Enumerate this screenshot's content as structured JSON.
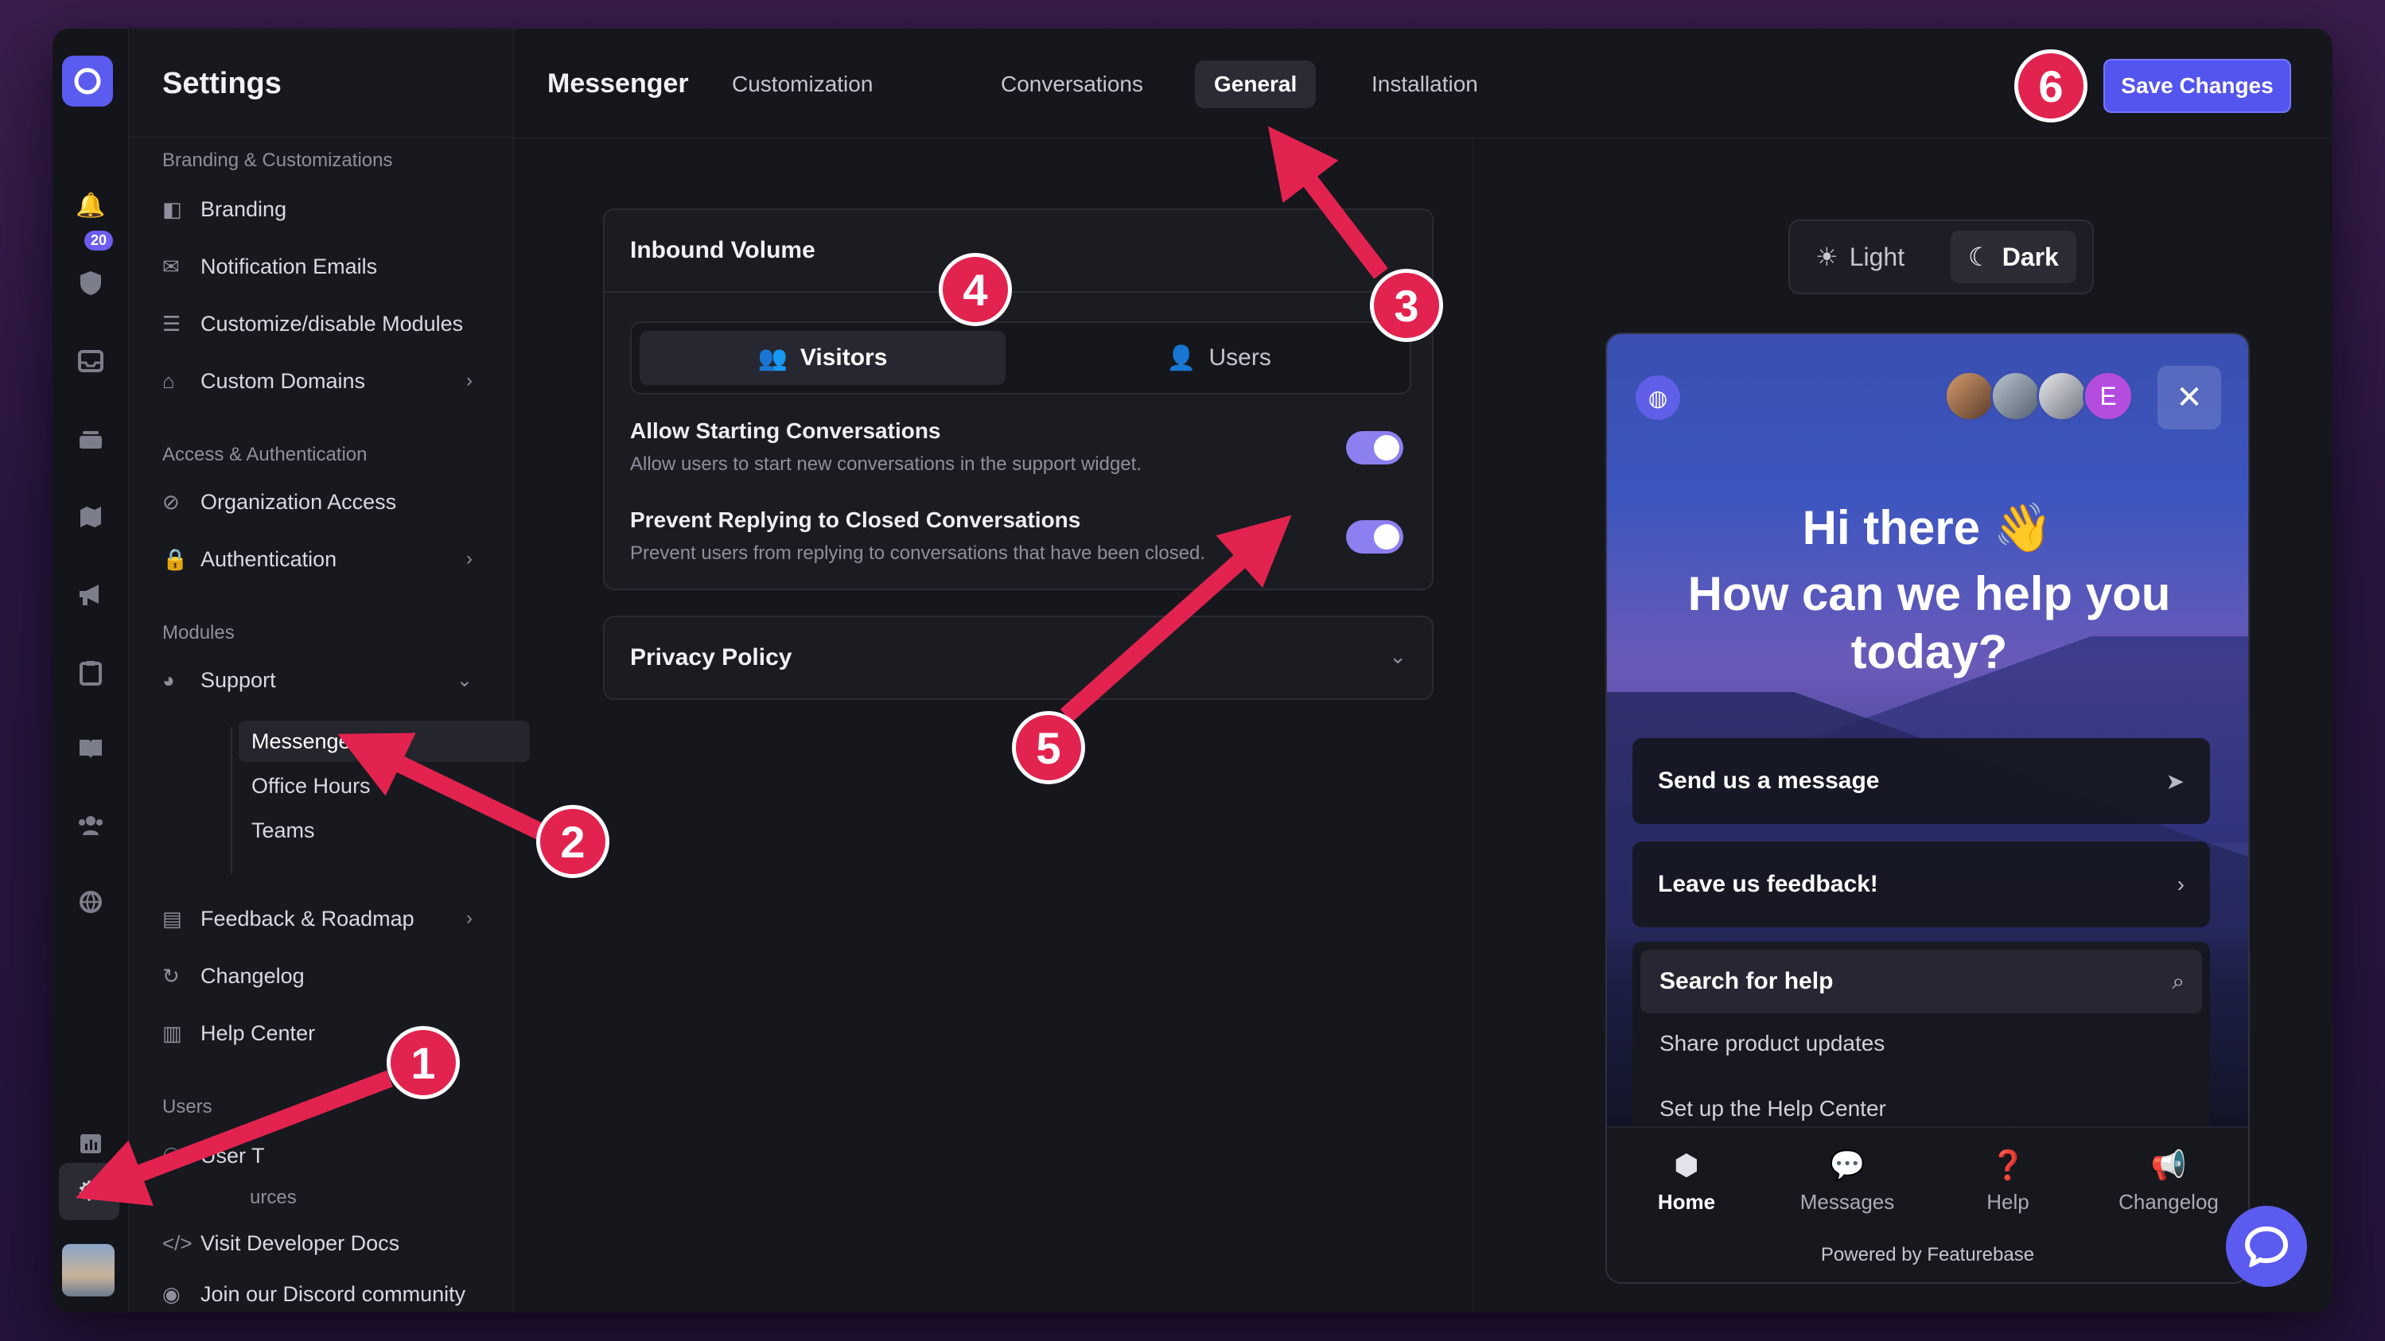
{
  "rail": {
    "badge": "20",
    "icons": [
      "bell-icon",
      "shield-check-icon",
      "inbox-icon",
      "stack-icon",
      "map-icon",
      "megaphone-icon",
      "clipboard-icon",
      "book-icon",
      "users-icon",
      "globe-icon",
      "chart-icon",
      "gear-icon"
    ]
  },
  "sidebar": {
    "title": "Settings",
    "sections": {
      "branding": "Branding & Customizations",
      "access": "Access & Authentication",
      "modules": "Modules",
      "users": "Users",
      "resources": "urces"
    },
    "items": {
      "branding": "Branding",
      "notification_emails": "Notification Emails",
      "customize_modules": "Customize/disable Modules",
      "custom_domains": "Custom Domains",
      "organization_access": "Organization Access",
      "authentication": "Authentication",
      "support": "Support",
      "messenger": "Messenger",
      "office_hours": "Office Hours",
      "teams": "Teams",
      "feedback_roadmap": "Feedback & Roadmap",
      "changelog": "Changelog",
      "help_center": "Help Center",
      "user_tags": "User T",
      "developer_docs": "Visit Developer Docs",
      "discord": "Join our Discord community"
    }
  },
  "topbar": {
    "title": "Messenger",
    "tabs": [
      "Customization",
      "Conversations",
      "General",
      "Installation"
    ],
    "active_tab": "General",
    "save_label": "Save Changes"
  },
  "inbound": {
    "title": "Inbound Volume",
    "segments": [
      "Visitors",
      "Users"
    ],
    "active_segment": "Visitors",
    "options": [
      {
        "title": "Allow Starting Conversations",
        "desc": "Allow users to start new conversations in the support widget.",
        "enabled": true
      },
      {
        "title": "Prevent Replying to Closed Conversations",
        "desc": "Prevent users from replying to conversations that have been closed.",
        "enabled": true
      }
    ]
  },
  "privacy": {
    "title": "Privacy Policy"
  },
  "preview": {
    "modes": [
      "Light",
      "Dark"
    ],
    "active_mode": "Dark",
    "avatar_letter": "E",
    "greeting": "Hi there 👋",
    "question": "How can we help you today?",
    "send_message": "Send us a message",
    "feedback": "Leave us feedback!",
    "search": "Search for help",
    "links": [
      "Share product updates",
      "Set up the Help Center"
    ],
    "nav": [
      "Home",
      "Messages",
      "Help",
      "Changelog"
    ],
    "powered_by": "Powered by Featurebase"
  },
  "annotations": [
    "1",
    "2",
    "3",
    "4",
    "5",
    "6"
  ],
  "colors": {
    "accent": "#5454ee",
    "annotation": "#e3234f",
    "toggle": "#8c7ff0"
  }
}
